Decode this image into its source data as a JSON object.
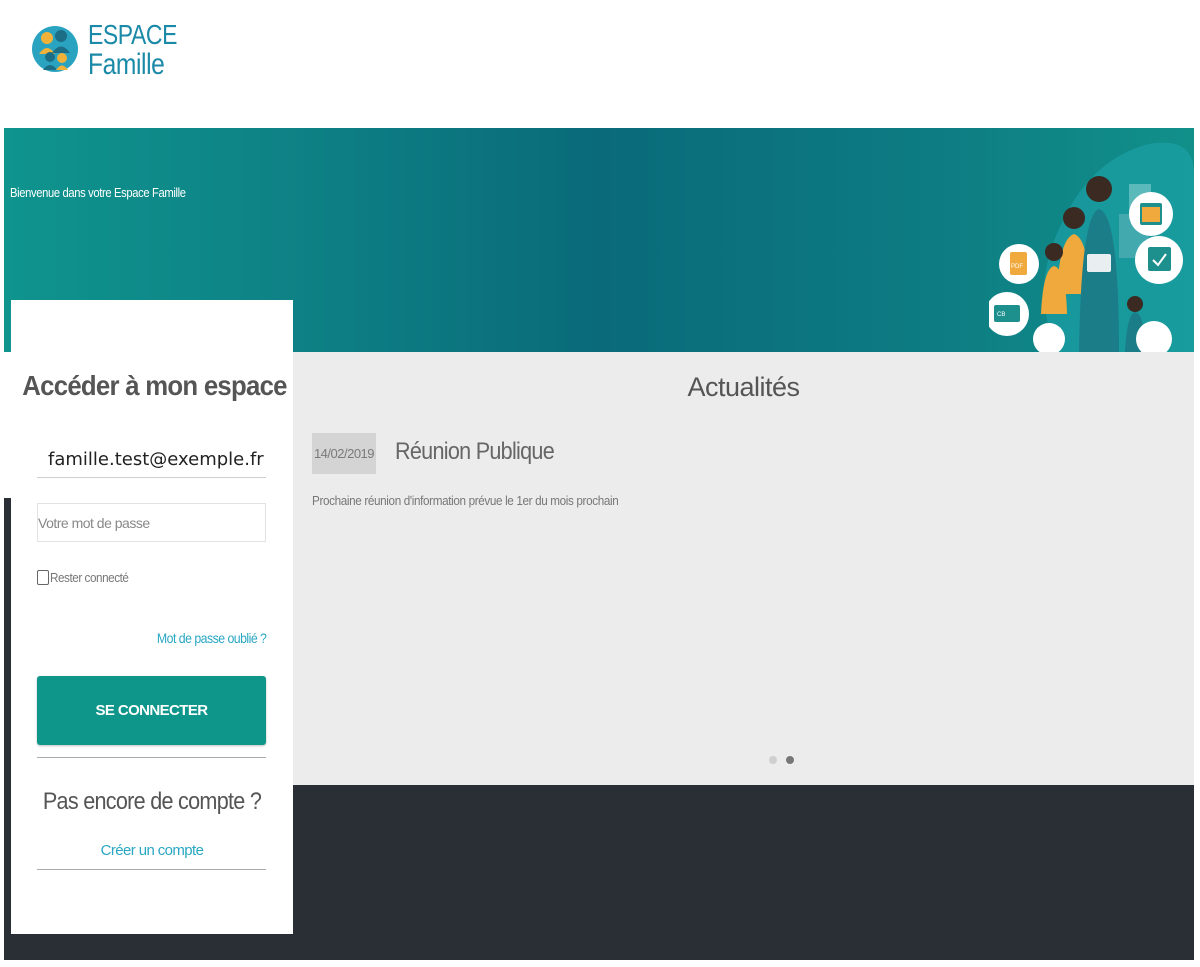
{
  "brand": {
    "line1": "ESPACE",
    "line2": "Famille",
    "logo_icon": "family-logo-icon",
    "color": "#1b8aa8"
  },
  "banner": {
    "welcome": "Bienvenue dans votre Espace Famille",
    "illustration": "family-illustration",
    "badges": {
      "pdf": "PDF",
      "card": "CB"
    },
    "color_start": "#0f948e",
    "color_mid": "#0a6a79"
  },
  "login": {
    "title": "Accéder à mon espace",
    "email_value": "famille.test@exemple.fr",
    "password_placeholder": "Votre mot de passe",
    "remember_label": "Rester connecté",
    "forgot_label": "Mot de passe oublié ?",
    "submit_label": "SE CONNECTER",
    "no_account": "Pas encore de compte ?",
    "create_label": "Créer un compte",
    "button_color": "#0f968a",
    "link_color": "#2aa7c3"
  },
  "news": {
    "title": "Actualités",
    "items": [
      {
        "date": "14/02/2019",
        "title": "Réunion Publique",
        "description": "Prochaine réunion d'information prévue le 1er du mois prochain"
      }
    ],
    "carousel": {
      "slides": 2,
      "active_index": 1
    }
  },
  "footer": {
    "color": "#2a2f36"
  }
}
